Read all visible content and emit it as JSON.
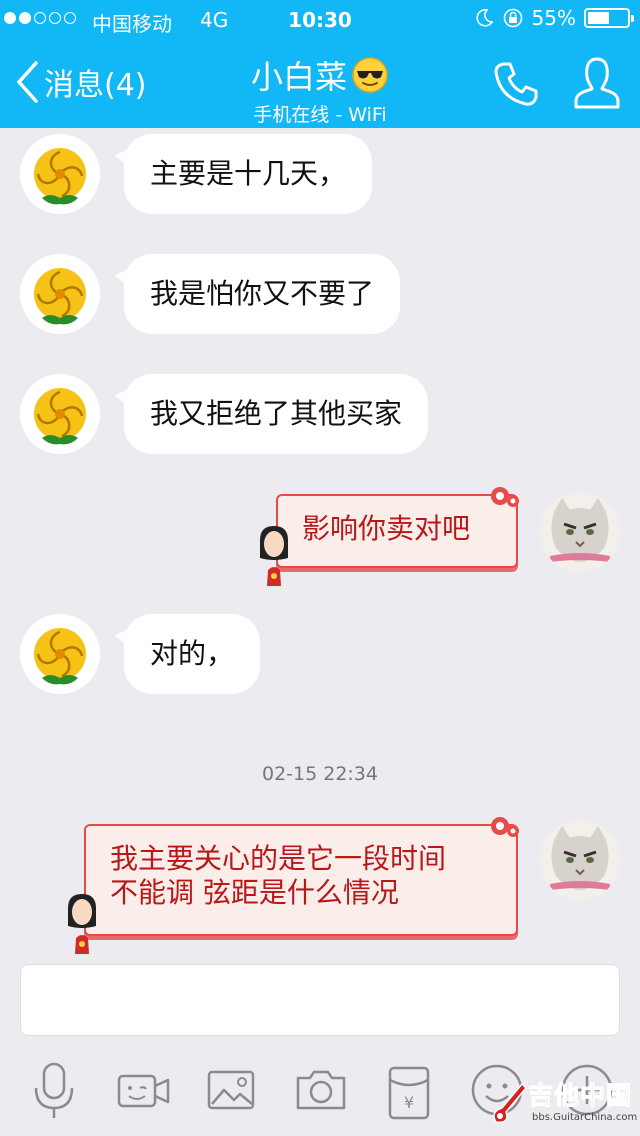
{
  "status_bar": {
    "carrier": "中国移动",
    "network": "4G",
    "time": "10:30",
    "battery": "55%",
    "battery_level": 0.55,
    "signal_strength": 2
  },
  "nav": {
    "back_label": "消息(4)",
    "title": "小白菜",
    "subtitle": "手机在线 - WiFi"
  },
  "messages": [
    {
      "side": "in",
      "text": "主要是十几天，"
    },
    {
      "side": "in",
      "text": "我是怕你又不要了"
    },
    {
      "side": "in",
      "text": "我又拒绝了其他买家"
    },
    {
      "side": "out",
      "text": "影响你卖对吧"
    },
    {
      "side": "in",
      "text": "对的，"
    },
    {
      "side": "out",
      "lines": [
        "我主要关心的是它一段时间",
        "不能调 弦距是什么情况"
      ]
    }
  ],
  "timestamp": "02-15 22:34",
  "input": {
    "value": ""
  },
  "toolbar": [
    "microphone-icon",
    "video-call-icon",
    "image-icon",
    "camera-icon",
    "red-packet-icon",
    "emoji-icon",
    "add-icon"
  ],
  "watermark": {
    "text": "吉他中国",
    "url": "bbs.GuitarChina.com"
  },
  "colors": {
    "header": "#12b7f5",
    "background": "#ebebf0",
    "bubble_out_text": "#b81818"
  }
}
